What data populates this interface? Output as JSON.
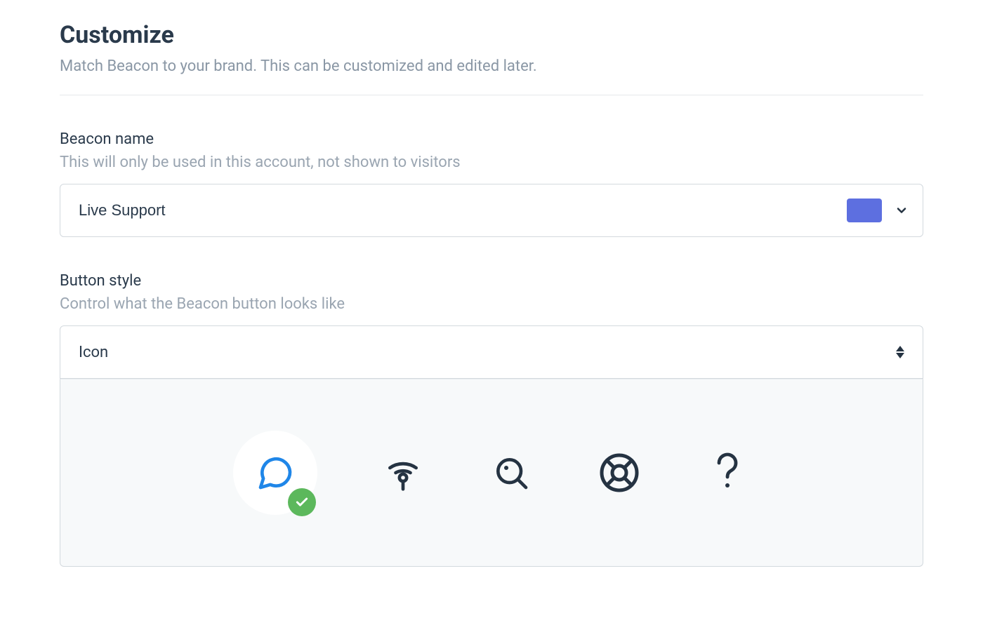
{
  "page": {
    "title": "Customize",
    "subtitle": "Match Beacon to your brand. This can be customized and edited later."
  },
  "beacon_name": {
    "label": "Beacon name",
    "hint": "This will only be used in this account, not shown to visitors",
    "value": "Live Support",
    "color": "#5d6fe0"
  },
  "button_style": {
    "label": "Button style",
    "hint": "Control what the Beacon button looks like",
    "selected": "Icon",
    "icons": [
      "chat",
      "beacon",
      "search",
      "lifebuoy",
      "question"
    ],
    "selected_icon": "chat"
  }
}
